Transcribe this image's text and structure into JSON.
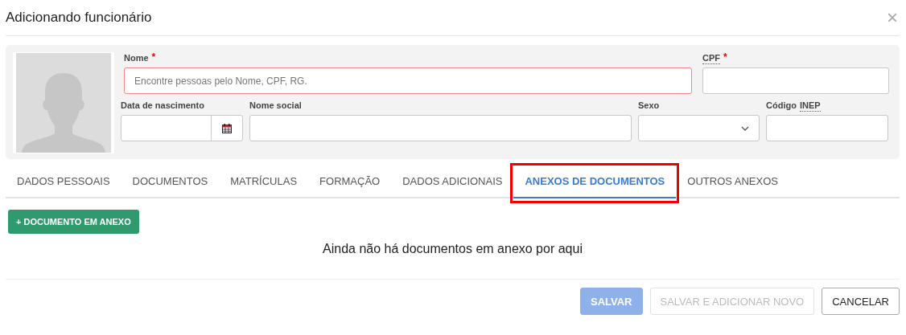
{
  "dialog": {
    "title": "Adicionando funcionário",
    "close": "×"
  },
  "form": {
    "top_fields": [
      {
        "label": "Nome",
        "required_mark": "*",
        "kind": "text",
        "placeholder": "Encontre pessoas pelo Nome, CPF, RG.",
        "invalid": true
      },
      {
        "label": "CPF",
        "required_mark": "*",
        "kind": "text",
        "invalid": false,
        "abbr": true
      }
    ],
    "bottom_fields": [
      {
        "label": "Data de nascimento",
        "kind": "date",
        "invalid": false
      },
      {
        "label": "Nome social",
        "kind": "text",
        "invalid": false
      },
      {
        "label": "Sexo",
        "kind": "select",
        "invalid": false
      },
      {
        "label": "Código",
        "label_abbr": "INEP",
        "kind": "text",
        "invalid": false
      }
    ]
  },
  "tabs": [
    {
      "label": "DADOS PESSOAIS",
      "selected": false,
      "highlighted": false
    },
    {
      "label": "DOCUMENTOS",
      "selected": false,
      "highlighted": false
    },
    {
      "label": "MATRÍCULAS",
      "selected": false,
      "highlighted": false
    },
    {
      "label": "FORMAÇÃO",
      "selected": false,
      "highlighted": false
    },
    {
      "label": "DADOS ADICIONAIS",
      "selected": false,
      "highlighted": false
    },
    {
      "label": "ANEXOS DE DOCUMENTOS",
      "selected": true,
      "highlighted": true
    },
    {
      "label": "OUTROS ANEXOS",
      "selected": false,
      "highlighted": false
    }
  ],
  "add_button": {
    "icon": "+",
    "label": "DOCUMENTO EM ANEXO"
  },
  "empty_message": "Ainda não há documentos em anexo por aqui",
  "footer_buttons": [
    {
      "label": "SALVAR",
      "kind": "primary",
      "disabled": true
    },
    {
      "label": "SALVAR E ADICIONAR NOVO",
      "kind": "default",
      "disabled": true
    },
    {
      "label": "CANCELAR",
      "kind": "default",
      "disabled": false
    }
  ]
}
